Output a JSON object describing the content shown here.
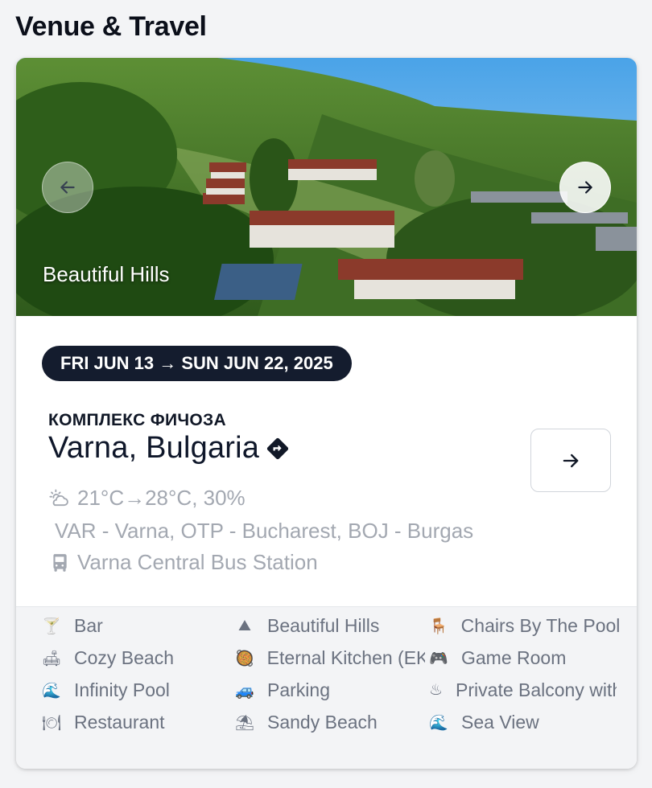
{
  "section": {
    "title": "Venue & Travel"
  },
  "hero": {
    "caption": "Beautiful Hills"
  },
  "dates": {
    "label": "FRI JUN 13 → SUN JUN 22, 2025"
  },
  "venue": {
    "name": "КОМПЛЕКС ФИЧОЗА",
    "location": "Varna, Bulgaria",
    "weather": "21°C→28°C, 30%",
    "airports": "VAR - Varna, OTP - Bucharest, BOJ - Burgas",
    "bus_station": "Varna Central Bus Station"
  },
  "amenities": [
    {
      "label": "Bar",
      "icon": "cocktail-icon"
    },
    {
      "label": "Beautiful Hills",
      "icon": "mountain-icon"
    },
    {
      "label": "Chairs By The Pool",
      "icon": "chair-icon"
    },
    {
      "label": "Cozy Beach",
      "icon": "sofa-icon"
    },
    {
      "label": "Eternal Kitchen (EK)",
      "icon": "kitchen-icon"
    },
    {
      "label": "Game Room",
      "icon": "gamepad-icon"
    },
    {
      "label": "Infinity Pool",
      "icon": "wave-icon"
    },
    {
      "label": "Parking",
      "icon": "car-icon"
    },
    {
      "label": "Private Balcony with",
      "icon": "hot-springs-icon"
    },
    {
      "label": "Restaurant",
      "icon": "plate-icon"
    },
    {
      "label": "Sandy Beach",
      "icon": "beach-icon"
    },
    {
      "label": "Sea View",
      "icon": "wave-icon"
    }
  ],
  "colors": {
    "badge_bg": "#141c2e",
    "muted_text": "#a3a8b1",
    "amenity_text": "#6b7280"
  }
}
